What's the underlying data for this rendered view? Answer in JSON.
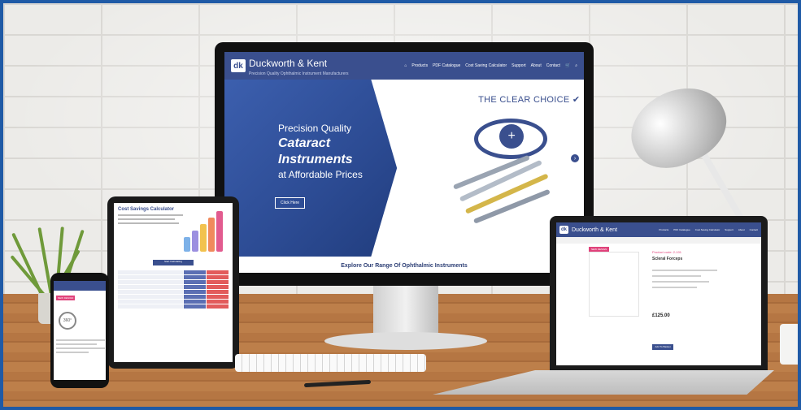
{
  "brand": {
    "name": "Duckworth & Kent",
    "logo_mark": "dk",
    "tagline": "Precision Quality Ophthalmic Instrument Manufacturers",
    "primary_color": "#3a4f8e",
    "accent_color": "#e0427b"
  },
  "desktop": {
    "nav": [
      "Products",
      "PDF Catalogue",
      "Cost Saving Calculator",
      "Support",
      "About",
      "Contact"
    ],
    "hero": {
      "line1": "Precision Quality",
      "line2": "Cataract",
      "line3": "Instruments",
      "line4": "at Affordable Prices",
      "button": "Click Here",
      "tag": "THE CLEAR CHOICE ✔"
    },
    "explore": "Explore Our Range Of Ophthalmic Instruments"
  },
  "tablet": {
    "title": "Cost Savings Calculator",
    "button": "Start Calculating"
  },
  "phone": {
    "badge": "NEW DESIGN",
    "viewer": "360°"
  },
  "laptop": {
    "badge": "NEW DESIGN",
    "product_code": "Product code: 2-101",
    "product_name": "Scleral Forceps",
    "price": "£125.00",
    "add_to_basket": "Add To Basket"
  }
}
